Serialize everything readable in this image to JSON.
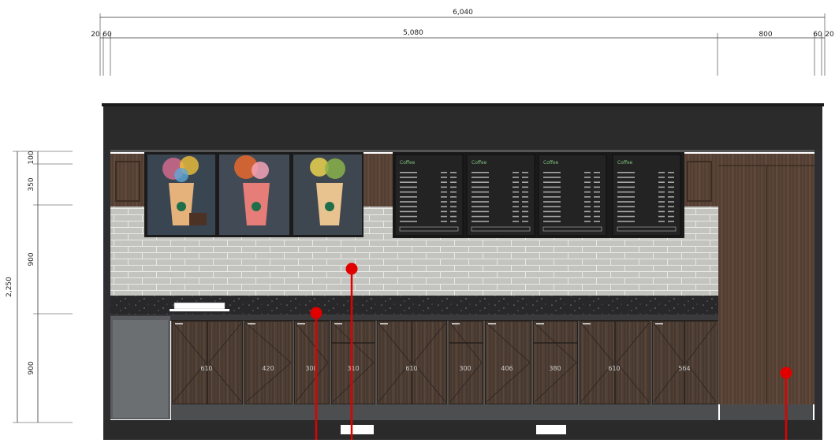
{
  "dimensions": {
    "top_total": "6,040",
    "top_left_a": "20",
    "top_left_b": "60",
    "top_main": "5,080",
    "top_right_main": "800",
    "top_right_a": "60",
    "top_right_b": "20",
    "left_total": "2,250",
    "left_a": "100",
    "left_b": "350",
    "left_c": "900",
    "left_d": "900"
  },
  "cabinets": [
    "610",
    "420",
    "300",
    "310",
    "610",
    "300",
    "406",
    "380",
    "610",
    "564"
  ],
  "menu_boards": [
    {
      "title": "Coffee"
    },
    {
      "title": "Coffee"
    },
    {
      "title": "Coffee"
    },
    {
      "title": "Coffee"
    }
  ],
  "colors": {
    "header": "#2b2b2c",
    "cabinet": "#4e3e34",
    "countertop": "#262627",
    "brick": "#bfc0bb",
    "wood_panel": "#5a4536",
    "marker": "#e00000"
  }
}
